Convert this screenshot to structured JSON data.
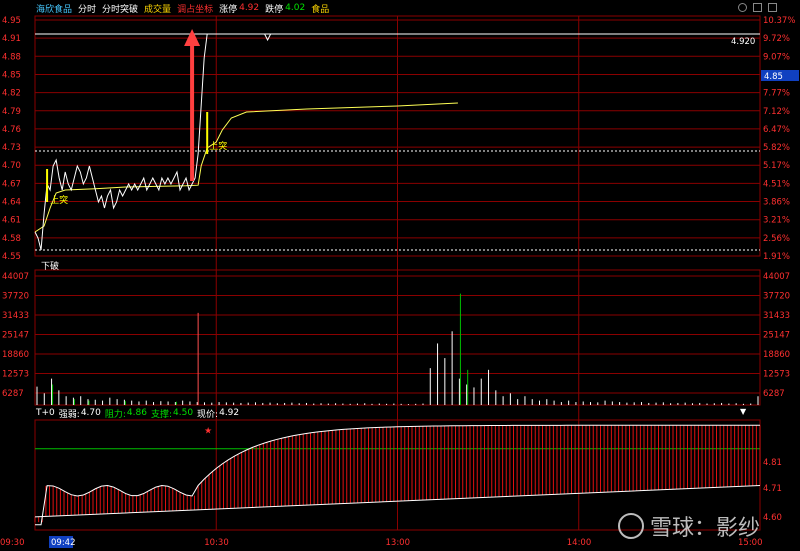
{
  "header": {
    "stock_name": "海欣食品",
    "tabs": [
      "分时",
      "分时突破",
      "成交量",
      "调占坐标"
    ],
    "limit_up_label": "涨停",
    "limit_up_value": "4.92",
    "limit_down_label": "跌停",
    "limit_down_value": "4.02",
    "sector": "食品"
  },
  "indicator": {
    "prefix": "T+0",
    "strong_label": "强弱:",
    "strong_value": "4.70",
    "resist_label": "阻力:",
    "resist_value": "4.86",
    "support_label": "支撑:",
    "support_value": "4.50",
    "price_label": "现价:",
    "price_value": "4.92"
  },
  "labels": {
    "breakout_up": "上突",
    "breakout_down": "下破",
    "last_price_tag": "4.85",
    "limit_line_value": "4.920",
    "time_cursor": "09:42"
  },
  "watermark": {
    "text": "雪球：影纱"
  },
  "colors": {
    "grid": "#8a0000",
    "up": "#ff3030",
    "down": "#00c000",
    "price": "#ffffff",
    "avg": "#ffff55",
    "arrow": "#ff4040"
  },
  "chart_data": [
    {
      "type": "line",
      "panel": "price",
      "y_ticks_left": [
        "4.95",
        "4.91",
        "4.88",
        "4.85",
        "4.82",
        "4.79",
        "4.76",
        "4.73",
        "4.70",
        "4.67",
        "4.64",
        "4.61",
        "4.58",
        "4.55"
      ],
      "y_ticks_right": [
        "10.37%",
        "9.72%",
        "9.07%",
        "8.42%",
        "7.77%",
        "7.12%",
        "6.47%",
        "5.82%",
        "5.17%",
        "4.51%",
        "3.86%",
        "3.21%",
        "2.56%",
        "1.91%"
      ],
      "ylim": [
        4.55,
        4.95
      ],
      "x_ticks": [
        "09:30",
        "10:30",
        "13:00",
        "14:00",
        "15:00"
      ],
      "series": [
        {
          "key": "price",
          "points": [
            [
              0,
              4.59
            ],
            [
              1,
              4.58
            ],
            [
              2,
              4.56
            ],
            [
              3,
              4.62
            ],
            [
              4,
              4.67
            ],
            [
              5,
              4.66
            ],
            [
              6,
              4.7
            ],
            [
              7,
              4.71
            ],
            [
              8,
              4.68
            ],
            [
              9,
              4.66
            ],
            [
              10,
              4.69
            ],
            [
              11,
              4.67
            ],
            [
              12,
              4.66
            ],
            [
              13,
              4.68
            ],
            [
              14,
              4.7
            ],
            [
              15,
              4.69
            ],
            [
              16,
              4.67
            ],
            [
              17,
              4.68
            ],
            [
              18,
              4.7
            ],
            [
              19,
              4.68
            ],
            [
              20,
              4.66
            ],
            [
              21,
              4.64
            ],
            [
              22,
              4.65
            ],
            [
              23,
              4.63
            ],
            [
              24,
              4.65
            ],
            [
              25,
              4.66
            ],
            [
              26,
              4.63
            ],
            [
              27,
              4.64
            ],
            [
              28,
              4.66
            ],
            [
              29,
              4.65
            ],
            [
              30,
              4.66
            ],
            [
              31,
              4.67
            ],
            [
              32,
              4.66
            ],
            [
              33,
              4.67
            ],
            [
              34,
              4.66
            ],
            [
              35,
              4.67
            ],
            [
              36,
              4.68
            ],
            [
              37,
              4.66
            ],
            [
              38,
              4.67
            ],
            [
              39,
              4.68
            ],
            [
              40,
              4.67
            ],
            [
              41,
              4.66
            ],
            [
              42,
              4.68
            ],
            [
              43,
              4.67
            ],
            [
              44,
              4.68
            ],
            [
              45,
              4.67
            ],
            [
              46,
              4.68
            ],
            [
              47,
              4.69
            ],
            [
              48,
              4.66
            ],
            [
              49,
              4.67
            ],
            [
              50,
              4.68
            ],
            [
              51,
              4.66
            ],
            [
              52,
              4.67
            ],
            [
              53,
              4.68
            ],
            [
              54,
              4.72
            ],
            [
              55,
              4.8
            ],
            [
              56,
              4.88
            ],
            [
              57,
              4.92
            ],
            [
              58,
              4.92
            ]
          ]
        },
        {
          "key": "avg",
          "points": [
            [
              0,
              4.59
            ],
            [
              3,
              4.6
            ],
            [
              5,
              4.63
            ],
            [
              7,
              4.655
            ],
            [
              10,
              4.66
            ],
            [
              20,
              4.662
            ],
            [
              30,
              4.665
            ],
            [
              40,
              4.666
            ],
            [
              50,
              4.667
            ],
            [
              54,
              4.668
            ],
            [
              55,
              4.7
            ],
            [
              57,
              4.73
            ],
            [
              60,
              4.74
            ],
            [
              62,
              4.76
            ],
            [
              65,
              4.78
            ],
            [
              70,
              4.79
            ],
            [
              90,
              4.795
            ],
            [
              120,
              4.8
            ],
            [
              140,
              4.805
            ]
          ]
        }
      ]
    },
    {
      "type": "bar",
      "panel": "volume",
      "y_ticks": [
        "44007",
        "37720",
        "31433",
        "25147",
        "18860",
        "12573",
        "6287"
      ],
      "ylim": [
        0,
        44007
      ],
      "values_up": [
        6287,
        4000,
        9000,
        5000,
        3000,
        2500,
        3000,
        2000,
        1800,
        1500,
        2500,
        2000,
        1800,
        1500,
        1200,
        1500,
        1000,
        1300,
        1200,
        1000,
        1500,
        1200,
        1000,
        900,
        800,
        1000,
        900,
        800,
        700,
        800,
        900,
        700,
        800,
        600,
        700,
        800,
        600,
        700,
        500,
        600,
        500,
        600,
        500,
        400,
        500,
        600,
        400,
        500,
        400,
        500,
        400,
        300,
        400,
        500,
        12573,
        21000,
        16000,
        25147,
        9000,
        7000,
        6000,
        9000,
        12000,
        5000,
        3000,
        4000,
        2000,
        3000,
        2000,
        1500,
        2000,
        1500,
        1000,
        1500,
        1000,
        1200,
        1000,
        900,
        1500,
        1200,
        1000,
        800,
        900,
        1000,
        700,
        800,
        900,
        600,
        700,
        800,
        600,
        700,
        500,
        600,
        700,
        500,
        600,
        400,
        500,
        3000
      ],
      "values_down": [
        0,
        0,
        7000,
        0,
        0,
        2000,
        0,
        1500,
        0,
        0,
        0,
        0,
        1300,
        0,
        0,
        0,
        0,
        0,
        0,
        1100,
        0,
        0,
        0,
        0,
        0,
        0,
        0,
        0,
        0,
        0,
        0,
        0,
        0,
        0,
        0,
        0,
        0,
        0,
        0,
        0,
        0,
        0,
        0,
        0,
        0,
        0,
        0,
        0,
        0,
        0,
        0,
        0,
        0,
        0,
        0,
        0,
        0,
        0,
        38000,
        12000,
        0,
        0,
        0,
        0,
        0,
        0,
        0,
        0,
        0,
        0,
        0,
        0,
        0,
        0,
        0,
        0,
        0,
        0,
        0,
        0,
        0,
        0,
        0,
        0,
        0,
        0,
        0,
        0,
        0,
        0,
        0,
        0,
        0,
        0,
        0,
        0,
        0,
        0,
        0,
        0,
        0
      ]
    },
    {
      "type": "bar",
      "panel": "indicator",
      "y_ticks": [
        "4.81",
        "4.71",
        "4.60"
      ],
      "ylim": [
        4.55,
        4.97
      ]
    }
  ]
}
